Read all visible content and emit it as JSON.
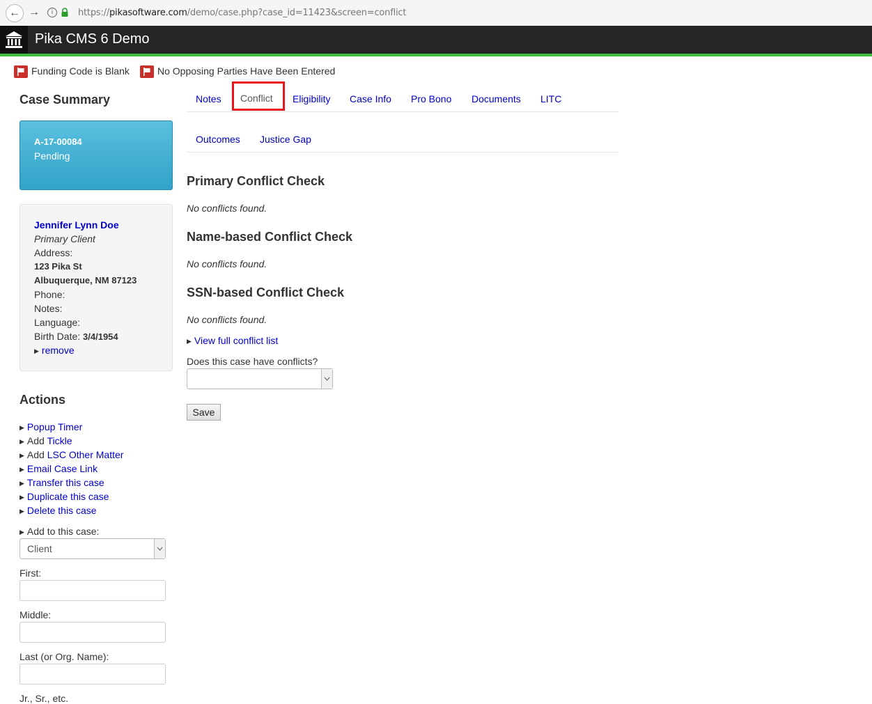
{
  "browser": {
    "url_prefix": "https://",
    "url_domain": "pikasoftware.com",
    "url_path": "/demo/case.php?case_id=11423&screen=conflict"
  },
  "app": {
    "title": "Pika CMS 6 Demo"
  },
  "alerts": [
    "Funding Code is Blank",
    "No Opposing Parties Have Been Entered"
  ],
  "sidebar": {
    "case_summary_title": "Case Summary",
    "case_number": "A-17-00084",
    "case_status": "Pending",
    "client": {
      "name": "Jennifer Lynn Doe",
      "role": "Primary Client",
      "address_label": "Address:",
      "street": "123 Pika St",
      "city": "Albuquerque, NM 87123",
      "phone_label": "Phone:",
      "notes_label": "Notes:",
      "language_label": "Language:",
      "birth_label": "Birth Date:",
      "birth_value": "3/4/1954",
      "remove_link": "remove"
    },
    "actions_title": "Actions",
    "actions": [
      {
        "prefix": "",
        "link": "Popup Timer"
      },
      {
        "prefix": "Add ",
        "link": "Tickle"
      },
      {
        "prefix": "Add ",
        "link": "LSC Other Matter"
      },
      {
        "prefix": "",
        "link": "Email Case Link"
      },
      {
        "prefix": "",
        "link": "Transfer this case"
      },
      {
        "prefix": "",
        "link": "Duplicate this case"
      },
      {
        "prefix": "",
        "link": "Delete this case"
      }
    ],
    "add_to_label": "Add to this case:",
    "add_to_value": "Client",
    "form": {
      "first_label": "First:",
      "middle_label": "Middle:",
      "last_label": "Last (or Org. Name):",
      "suffix_label": "Jr., Sr., etc."
    }
  },
  "tabs": {
    "row1": [
      "Notes",
      "Conflict",
      "Eligibility",
      "Case Info",
      "Pro Bono",
      "Documents",
      "LITC"
    ],
    "row2": [
      "Outcomes",
      "Justice Gap"
    ],
    "active": "Conflict"
  },
  "main": {
    "primary_title": "Primary Conflict Check",
    "primary_result": "No conflicts found.",
    "name_title": "Name-based Conflict Check",
    "name_result": "No conflicts found.",
    "ssn_title": "SSN-based Conflict Check",
    "ssn_result": "No conflicts found.",
    "view_full_link": "View full conflict list",
    "conflict_question": "Does this case have conflicts?",
    "conflict_value": "",
    "save_label": "Save"
  },
  "colors": {
    "header_bg": "#252525",
    "header_accent": "#3dbd3d",
    "case_box": "#31a2c8",
    "active_tab_outline": "#e8141b",
    "flag": "#c9302c",
    "link": "#0000cc"
  }
}
